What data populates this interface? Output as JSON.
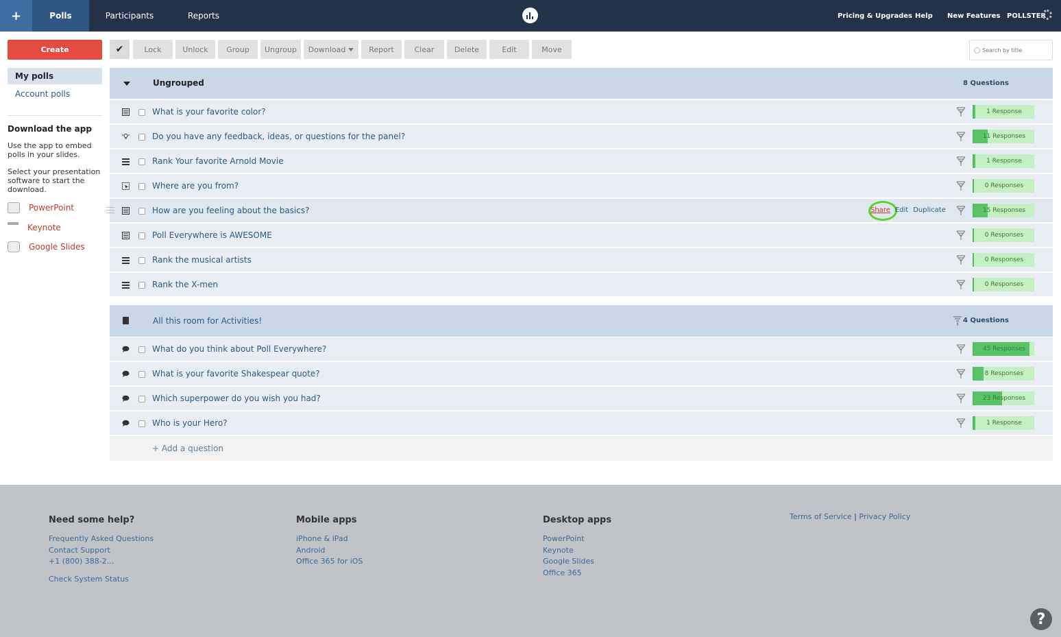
{
  "nav": {
    "plus": "+",
    "tabs": [
      "Polls",
      "Participants",
      "Reports"
    ],
    "right": [
      "Pricing & Upgrades",
      "Help",
      "New Features",
      "POLLSTER"
    ]
  },
  "toolbar": {
    "create": "Create",
    "check": "✔",
    "lock": "Lock",
    "unlock": "Unlock",
    "group": "Group",
    "ungroup": "Ungroup",
    "download": "Download",
    "report": "Report",
    "clear": "Clear",
    "delete": "Delete",
    "edit": "Edit",
    "move": "Move",
    "search_placeholder": "Search by title"
  },
  "sidebar": {
    "my_polls": "My polls",
    "account_polls": "Account polls",
    "download_heading": "Download the app",
    "download_p1": "Use the app to embed polls in your slides.",
    "download_p2": "Select your presentation software to start the download.",
    "apps": [
      "PowerPoint",
      "Keynote",
      "Google Slides"
    ]
  },
  "groups": [
    {
      "title": "Ungrouped",
      "count": "8 Questions",
      "rows": [
        {
          "icon": "multiple-choice-icon",
          "title": "What is your favorite color?",
          "responses": "1 Response",
          "fill": 0.02
        },
        {
          "icon": "brainstorm-icon",
          "title": "Do you have any feedback, ideas, or questions for the panel?",
          "responses": "11 Responses",
          "fill": 0.22
        },
        {
          "icon": "ranking-icon",
          "title": "Rank Your favorite Arnold Movie",
          "responses": "1 Response",
          "fill": 0.02
        },
        {
          "icon": "clickable-image-icon",
          "title": "Where are you from?",
          "responses": "0 Responses",
          "fill": 0.0
        },
        {
          "icon": "multiple-choice-icon",
          "title": "How are you feeling about the basics?",
          "responses": "15 Responses",
          "fill": 0.22
        },
        {
          "icon": "multiple-choice-icon",
          "title": "Poll Everywhere is AWESOME",
          "responses": "0 Responses",
          "fill": 0.0
        },
        {
          "icon": "ranking-icon",
          "title": "Rank the musical artists",
          "responses": "0 Responses",
          "fill": 0.0
        },
        {
          "icon": "ranking-icon",
          "title": "Rank the X-men",
          "responses": "0 Responses",
          "fill": 0.0
        }
      ]
    },
    {
      "title": "All this room for Activities!",
      "count": "4 Questions",
      "rows": [
        {
          "icon": "open-ended-icon",
          "title": "What do you think about Poll Everywhere?",
          "responses": "45 Responses",
          "fill": 0.9
        },
        {
          "icon": "open-ended-icon",
          "title": "What is your favorite Shakespear quote?",
          "responses": "8 Responses",
          "fill": 0.16
        },
        {
          "icon": "open-ended-icon",
          "title": "Which superpower do you wish you had?",
          "responses": "23 Responses",
          "fill": 0.46
        },
        {
          "icon": "open-ended-icon",
          "title": "Who is your Hero?",
          "responses": "1 Response",
          "fill": 0.02
        }
      ]
    }
  ],
  "row_actions": [
    "Share",
    "Edit",
    "Duplicate"
  ],
  "add_question": "+ Add a question",
  "footer": {
    "help_heading": "Need some help?",
    "help_links": [
      "Frequently Asked Questions",
      "Contact Support",
      "+1 (800) 388-2..."
    ],
    "status_link": "Check System Status",
    "mobile_heading": "Mobile apps",
    "mobile_links": [
      "iPhone & iPad",
      "Android",
      "Office 365 for iOS"
    ],
    "desktop_heading": "Desktop apps",
    "desktop_links": [
      "PowerPoint",
      "Keynote",
      "Google Slides",
      "Office 365"
    ],
    "terms": "Terms of Service",
    "sep": "|",
    "privacy": "Privacy Policy"
  },
  "help_button": "?"
}
